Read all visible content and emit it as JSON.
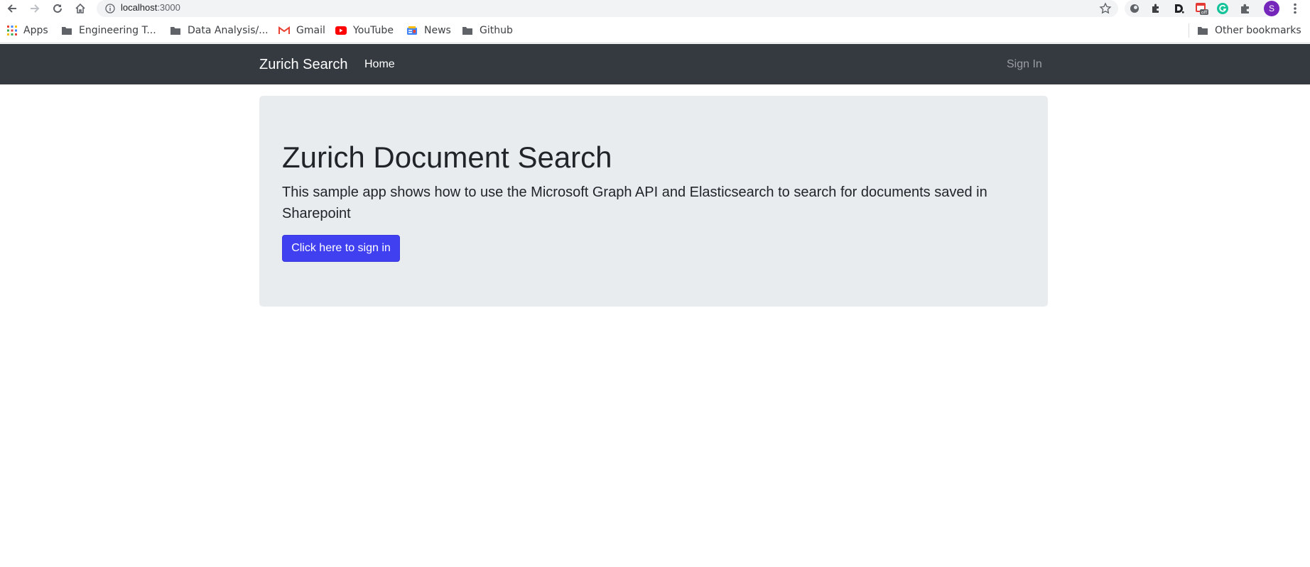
{
  "browser": {
    "url_host": "localhost",
    "url_port": ":3000",
    "avatar_letter": "S",
    "extension_badge": "off"
  },
  "bookmarks": {
    "items": [
      {
        "label": "Apps",
        "icon": "apps-grid-icon"
      },
      {
        "label": "Engineering T...",
        "icon": "folder-icon"
      },
      {
        "label": "Data Analysis/...",
        "icon": "folder-icon"
      },
      {
        "label": "Gmail",
        "icon": "gmail-icon"
      },
      {
        "label": "YouTube",
        "icon": "youtube-icon"
      },
      {
        "label": "News",
        "icon": "news-icon"
      },
      {
        "label": "Github",
        "icon": "folder-icon"
      }
    ],
    "other": "Other bookmarks"
  },
  "navbar": {
    "brand": "Zurich Search",
    "home": "Home",
    "sign_in": "Sign In",
    "bg_color": "#343a40"
  },
  "jumbotron": {
    "title": "Zurich Document Search",
    "lead": "This sample app shows how to use the Microsoft Graph API and Elasticsearch to search for documents saved in Sharepoint",
    "button": "Click here to sign in",
    "button_color": "#4040f0",
    "bg_color": "#e9ecef"
  }
}
